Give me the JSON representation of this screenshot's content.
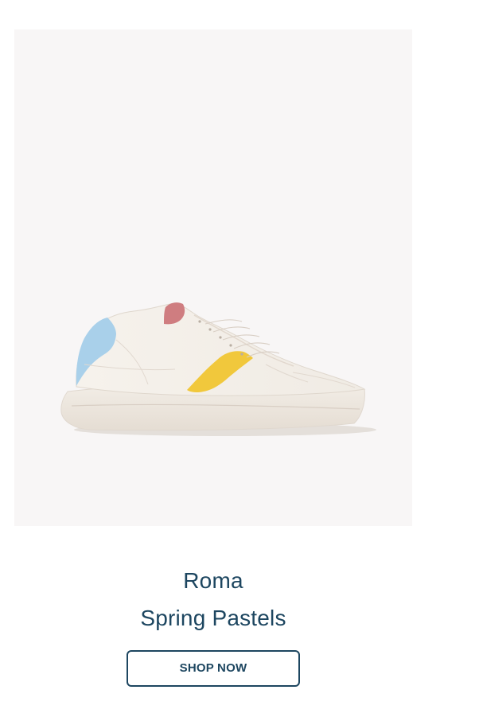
{
  "product": {
    "image_alt": "Cream sneaker with blue heel, pink heel tab and yellow side accent",
    "name": "Roma",
    "colorway": "Spring Pastels",
    "cta_label": "SHOP NOW"
  },
  "colors": {
    "text": "#1d4660",
    "image_background": "#f8f6f6",
    "button_border": "#1d4660",
    "sneaker_upper": "#f3eee8",
    "sneaker_sole": "#ece6dd",
    "heel_blue": "#a9d0ea",
    "heel_tab_pink": "#cf7d80",
    "side_accent_yellow": "#f1c83c"
  },
  "icons": [
    "sneaker-image"
  ]
}
